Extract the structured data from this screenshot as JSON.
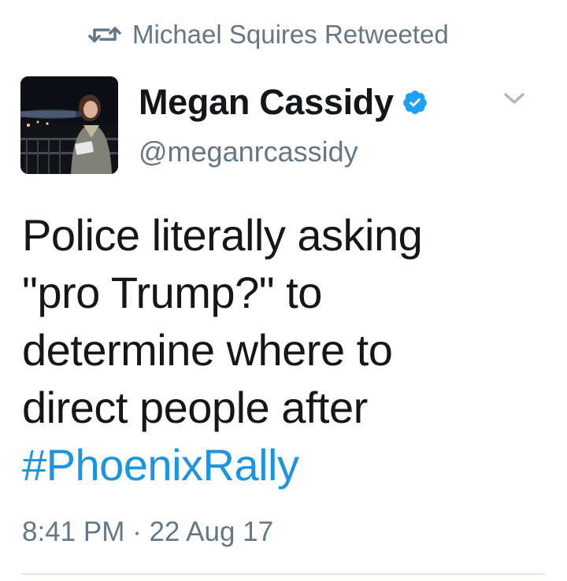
{
  "retweet": {
    "icon": "retweet-icon",
    "text": "Michael Squires Retweeted"
  },
  "author": {
    "avatar": "avatar-image",
    "display_name": "Megan Cassidy",
    "verified_icon": "verified-badge-icon",
    "handle": "@meganrcassidy"
  },
  "menu": {
    "icon": "chevron-down-icon"
  },
  "tweet": {
    "lines": [
      "Police literally asking",
      "\"pro Trump?\" to",
      "determine where to",
      "direct people after"
    ],
    "hashtag": "#PhoenixRally",
    "timestamp": "8:41 PM · 22 Aug 17"
  },
  "colors": {
    "text": "#14171a",
    "secondary": "#657786",
    "link": "#1b95e0",
    "verified": "#1da1f2",
    "divider": "#e1e8ed"
  }
}
